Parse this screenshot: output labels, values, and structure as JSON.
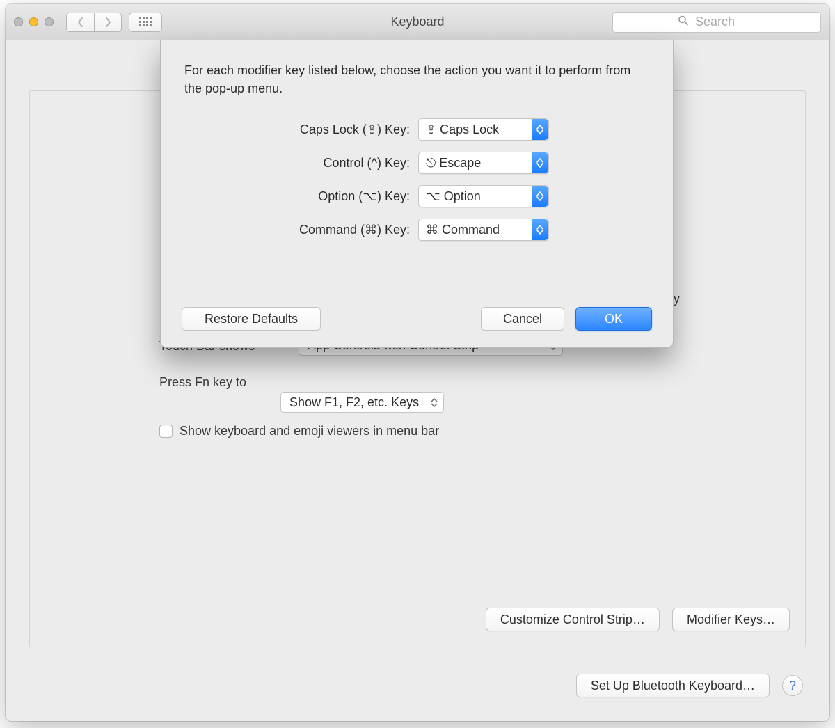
{
  "window": {
    "title": "Keyboard",
    "search_placeholder": "Search"
  },
  "panel": {
    "touchbar_label": "Touch Bar shows",
    "touchbar_value": "App Controls with Control Strip",
    "fn_label": "Press Fn key to",
    "fn_value": "Show F1, F2, etc. Keys",
    "checkbox_label": "Show keyboard and emoji viewers in menu bar",
    "customize_control_strip": "Customize Control Strip…",
    "modifier_keys": "Modifier Keys…",
    "bluetooth_keyboard": "Set Up Bluetooth Keyboard…",
    "repeat_label_fragment": "ty"
  },
  "sheet": {
    "instructions": "For each modifier key listed below, choose the action you want it to perform from the pop-up menu.",
    "rows": [
      {
        "label": "Caps Lock (⇪) Key:",
        "value": "⇪ Caps Lock"
      },
      {
        "label": "Control (^) Key:",
        "value": "⎋ Escape"
      },
      {
        "label": "Option (⌥) Key:",
        "value": "⌥ Option"
      },
      {
        "label": "Command (⌘) Key:",
        "value": "⌘ Command"
      }
    ],
    "restore": "Restore Defaults",
    "cancel": "Cancel",
    "ok": "OK"
  }
}
